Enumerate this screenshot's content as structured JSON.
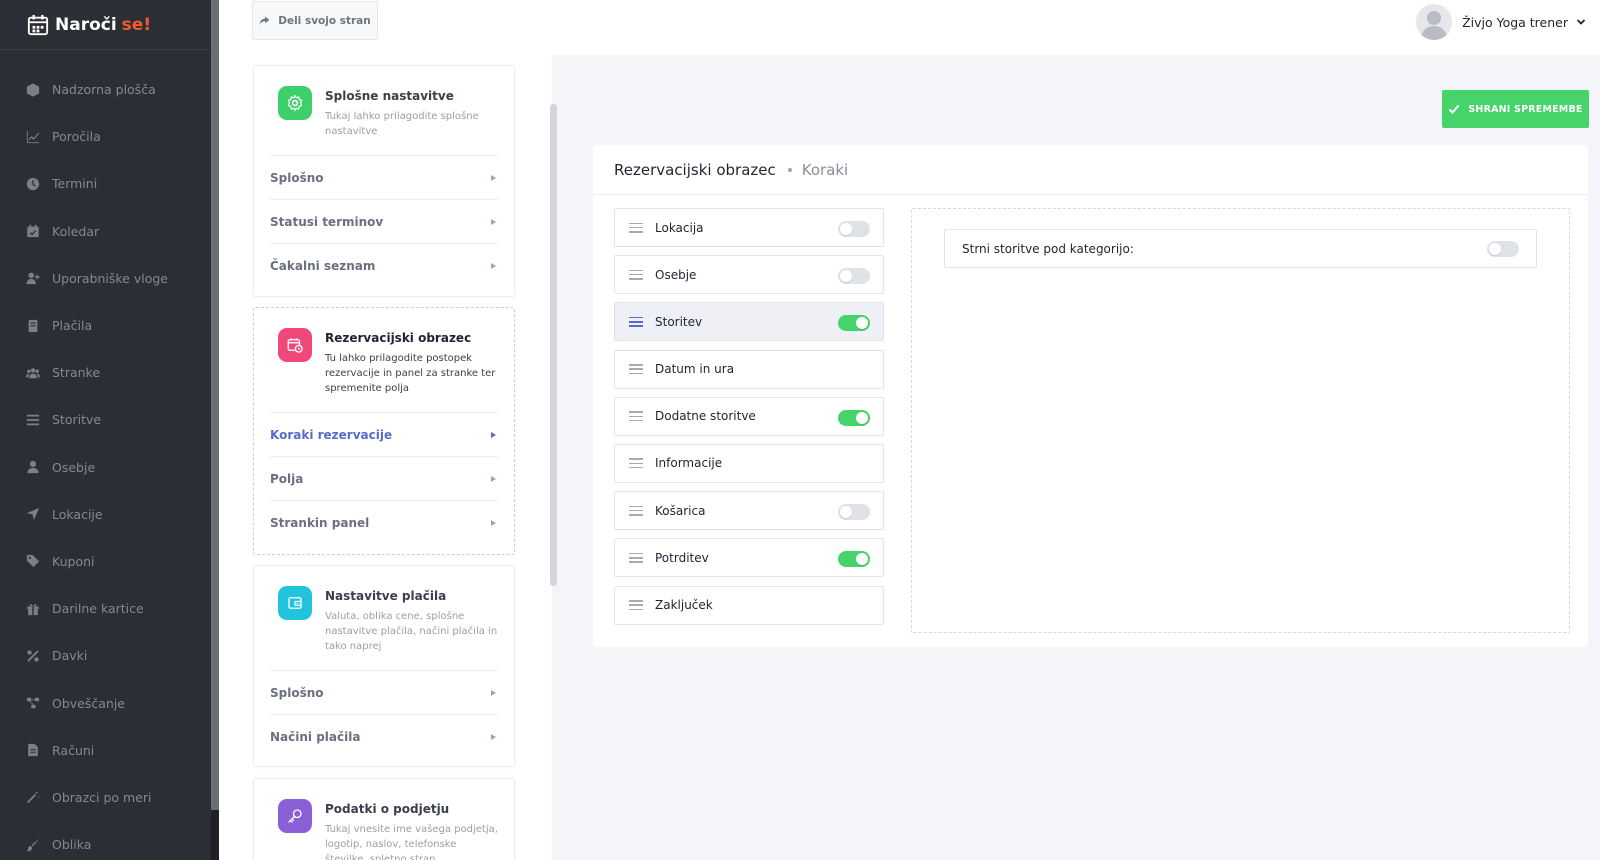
{
  "brand": {
    "name_part1": "Naroči",
    "name_part2": "se!"
  },
  "sidebar": {
    "items": [
      {
        "label": "Nadzorna plošča",
        "icon": "cube-icon"
      },
      {
        "label": "Poročila",
        "icon": "chart-icon"
      },
      {
        "label": "Termini",
        "icon": "clock-icon"
      },
      {
        "label": "Koledar",
        "icon": "calendar-icon"
      },
      {
        "label": "Uporabniške vloge",
        "icon": "user-plus-icon"
      },
      {
        "label": "Plačila",
        "icon": "card-icon"
      },
      {
        "label": "Stranke",
        "icon": "users-icon"
      },
      {
        "label": "Storitve",
        "icon": "list-icon"
      },
      {
        "label": "Osebje",
        "icon": "user-icon"
      },
      {
        "label": "Lokacije",
        "icon": "location-arrow-icon"
      },
      {
        "label": "Kuponi",
        "icon": "tag-icon"
      },
      {
        "label": "Darilne kartice",
        "icon": "gift-icon"
      },
      {
        "label": "Davki",
        "icon": "percent-icon"
      },
      {
        "label": "Obveščanje",
        "icon": "share-nodes-icon"
      },
      {
        "label": "Računi",
        "icon": "file-icon"
      },
      {
        "label": "Obrazci po meri",
        "icon": "magic-wand-icon"
      },
      {
        "label": "Oblika",
        "icon": "brush-icon"
      }
    ]
  },
  "topbar": {
    "share_label": "Deli svojo stran",
    "user_name": "Živjo Yoga trener"
  },
  "settings_cards": {
    "general": {
      "title": "Splošne nastavitve",
      "desc": "Tukaj lahko prilagodite splošne nastavitve",
      "links": [
        "Splošno",
        "Statusi terminov",
        "Čakalni seznam"
      ]
    },
    "booking_form": {
      "title": "Rezervacijski obrazec",
      "desc": "Tu lahko prilagodite postopek rezervacije in panel za stranke ter spremenite polja",
      "links": [
        "Koraki rezervacije",
        "Polja",
        "Strankin panel"
      ]
    },
    "payments": {
      "title": "Nastavitve plačila",
      "desc": "Valuta, oblika cene, splošne nastavitve plačila, načini plačila in tako naprej",
      "links": [
        "Splošno",
        "Načini plačila"
      ]
    },
    "company": {
      "title": "Podatki o podjetju",
      "desc": "Tukaj vnesite ime vašega podjetja, logotip, naslov, telefonske številke, spletno stran"
    }
  },
  "save_label": "SHRANI SPREMEMBE",
  "panel": {
    "breadcrumb_main": "Rezervacijski obrazec",
    "breadcrumb_sub": "Koraki",
    "steps": [
      {
        "label": "Lokacija",
        "toggle": "off"
      },
      {
        "label": "Osebje",
        "toggle": "off"
      },
      {
        "label": "Storitev",
        "toggle": "on",
        "active": true
      },
      {
        "label": "Datum in ura",
        "toggle": "none"
      },
      {
        "label": "Dodatne storitve",
        "toggle": "on"
      },
      {
        "label": "Informacije",
        "toggle": "none"
      },
      {
        "label": "Košarica",
        "toggle": "off"
      },
      {
        "label": "Potrditev",
        "toggle": "on"
      },
      {
        "label": "Zaključek",
        "toggle": "none"
      }
    ],
    "step_setting_label": "Strni storitve pod kategorijo:",
    "step_setting_toggle": "off"
  },
  "colors": {
    "accent": "#5a6acf",
    "success": "#46d36a",
    "brand_orange": "#f05a28",
    "sidebar_bg": "#2b2e34",
    "icon_green": "#3ecf6b",
    "icon_pink": "#f0487a",
    "icon_cyan": "#22c3dd",
    "icon_purple": "#8b5fd6"
  }
}
